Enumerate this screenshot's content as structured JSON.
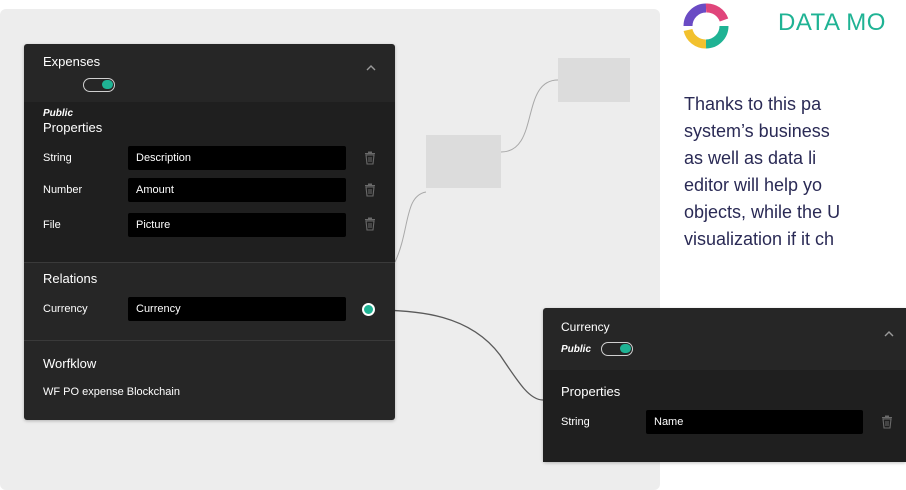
{
  "colors": {
    "accent": "#1fb394",
    "panel": "#262626",
    "text_dark": "#2a2a55"
  },
  "expenses_panel": {
    "title": "Expenses",
    "collapse_icon": "chevron-up-icon",
    "public_toggle": true,
    "public_label": "Public",
    "properties_title": "Properties",
    "properties": [
      {
        "type": "String",
        "value": "Description"
      },
      {
        "type": "Number",
        "value": "Amount"
      },
      {
        "type": "File",
        "value": "Picture"
      }
    ],
    "relations_title": "Relations",
    "relation": {
      "type": "Currency",
      "value": "Currency"
    },
    "workflow_title": "Worfklow",
    "workflow_value": "WF PO expense Blockchain"
  },
  "currency_panel": {
    "title": "Currency",
    "collapse_icon": "chevron-up-icon",
    "public_label": "Public",
    "public_toggle": true,
    "properties_title": "Properties",
    "properties": [
      {
        "type": "String",
        "value": "Name"
      }
    ]
  },
  "brand": {
    "title": "DATA MO",
    "logo_icon": "ring-logo-icon"
  },
  "description_lines": [
    "Thanks to this pa",
    "system’s business",
    "as well as data li",
    "editor will help yo",
    "objects, while the U",
    "visualization if it ch"
  ]
}
